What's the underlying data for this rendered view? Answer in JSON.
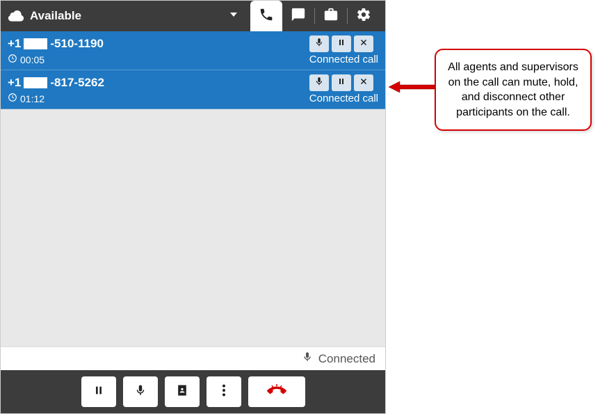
{
  "header": {
    "status": "Available"
  },
  "calls": [
    {
      "prefix": "+1",
      "suffix": "-510-1190",
      "duration": "00:05",
      "status": "Connected call"
    },
    {
      "prefix": "+1",
      "suffix": "-817-5262",
      "duration": "01:12",
      "status": "Connected call"
    }
  ],
  "status_bar": {
    "label": "Connected"
  },
  "callout": {
    "text": "All agents and supervisors on the call can mute, hold, and disconnect other participants on the call."
  }
}
